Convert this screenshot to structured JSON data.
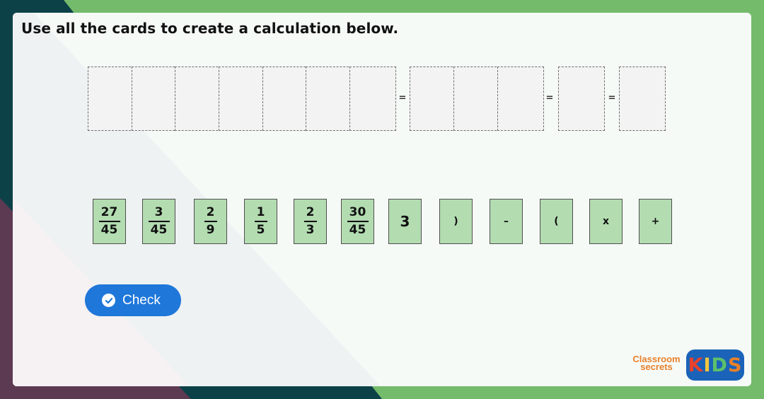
{
  "title": "Use all the cards to create a calculation below.",
  "equals_sign": "=",
  "cards": [
    {
      "numerator": "27",
      "denominator": "45"
    },
    {
      "numerator": "3",
      "denominator": "45"
    },
    {
      "numerator": "2",
      "denominator": "9"
    },
    {
      "numerator": "1",
      "denominator": "5"
    },
    {
      "numerator": "2",
      "denominator": "3"
    },
    {
      "numerator": "30",
      "denominator": "45"
    },
    {
      "value": "3"
    },
    {
      "value": ")"
    },
    {
      "value": "–"
    },
    {
      "value": "("
    },
    {
      "value": "x"
    },
    {
      "value": "+"
    }
  ],
  "check_button": {
    "label": "Check",
    "icon": "check-circle-icon"
  },
  "logos": {
    "classroom_secrets": {
      "line1": "Classroom",
      "line2": "secrets"
    },
    "kids": {
      "letters": [
        "K",
        "I",
        "D",
        "S"
      ],
      "colors": [
        "#e8412b",
        "#f4c63d",
        "#5cc06b",
        "#e8812b"
      ]
    }
  },
  "colors": {
    "card_fill": "#b3dcb1",
    "button": "#1f77d9",
    "outer_green": "#74bb6b",
    "teal": "#0c4148",
    "plum": "#5c3a52"
  }
}
